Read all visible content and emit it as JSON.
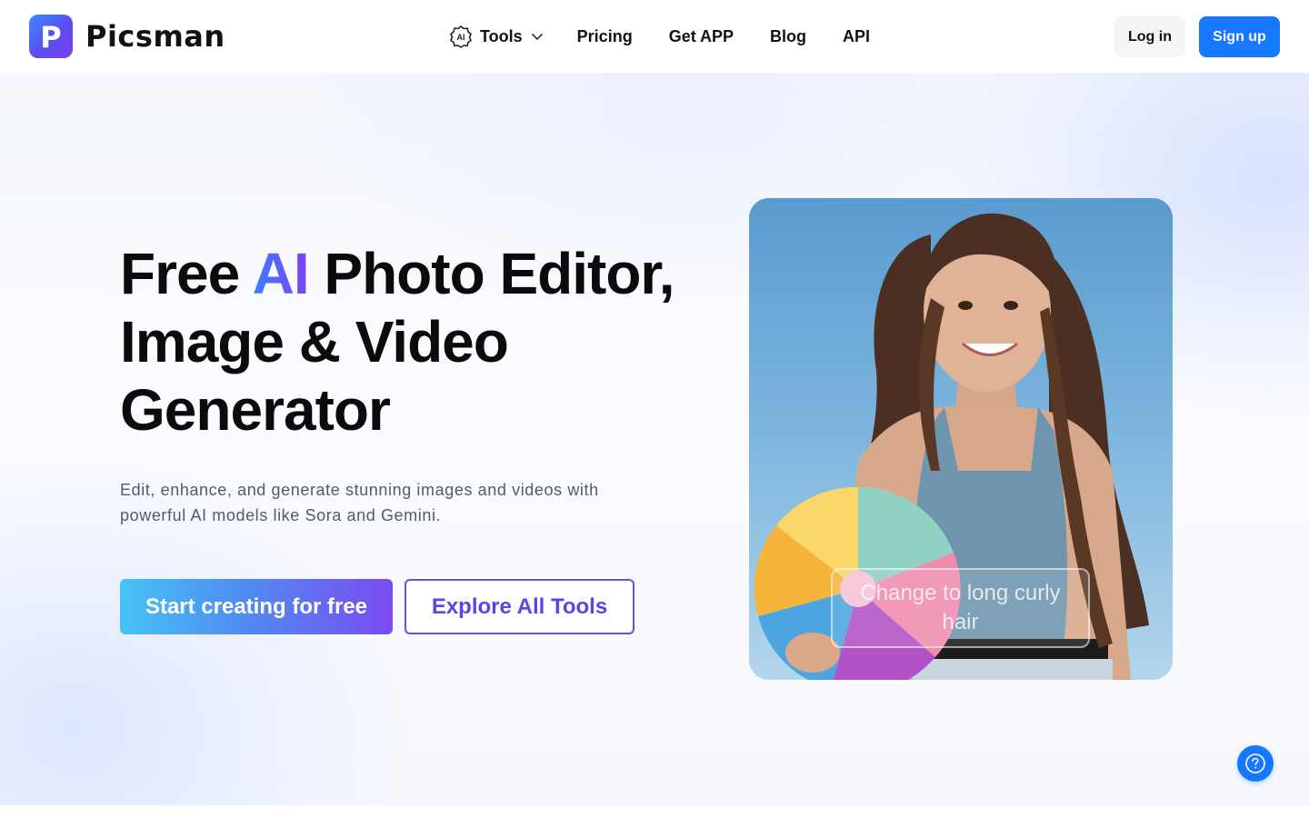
{
  "header": {
    "brand": "Picsman",
    "logo_letter": "P",
    "nav": [
      {
        "label": "Tools",
        "has_dropdown": true,
        "icon": "ai-badge-icon"
      },
      {
        "label": "Pricing"
      },
      {
        "label": "Get APP"
      },
      {
        "label": "Blog"
      },
      {
        "label": "API"
      }
    ],
    "ai_badge_text": "AI",
    "login_label": "Log in",
    "signup_label": "Sign up"
  },
  "hero": {
    "title_part1": "Free ",
    "title_ai": "AI",
    "title_part2": " Photo Editor, Image & Video Generator",
    "subtitle": "Edit, enhance, and generate stunning images and videos with powerful AI models like Sora and Gemini.",
    "primary_cta": "Start creating for free",
    "secondary_cta": "Explore All Tools",
    "image_prompt": "Change to long curly hair"
  },
  "help": {
    "icon": "question-circle-icon"
  },
  "colors": {
    "primary": "#1677ff",
    "gradient_start": "#46c3f5",
    "gradient_end": "#7b4cf0",
    "explore_border": "#6a4fe3"
  }
}
